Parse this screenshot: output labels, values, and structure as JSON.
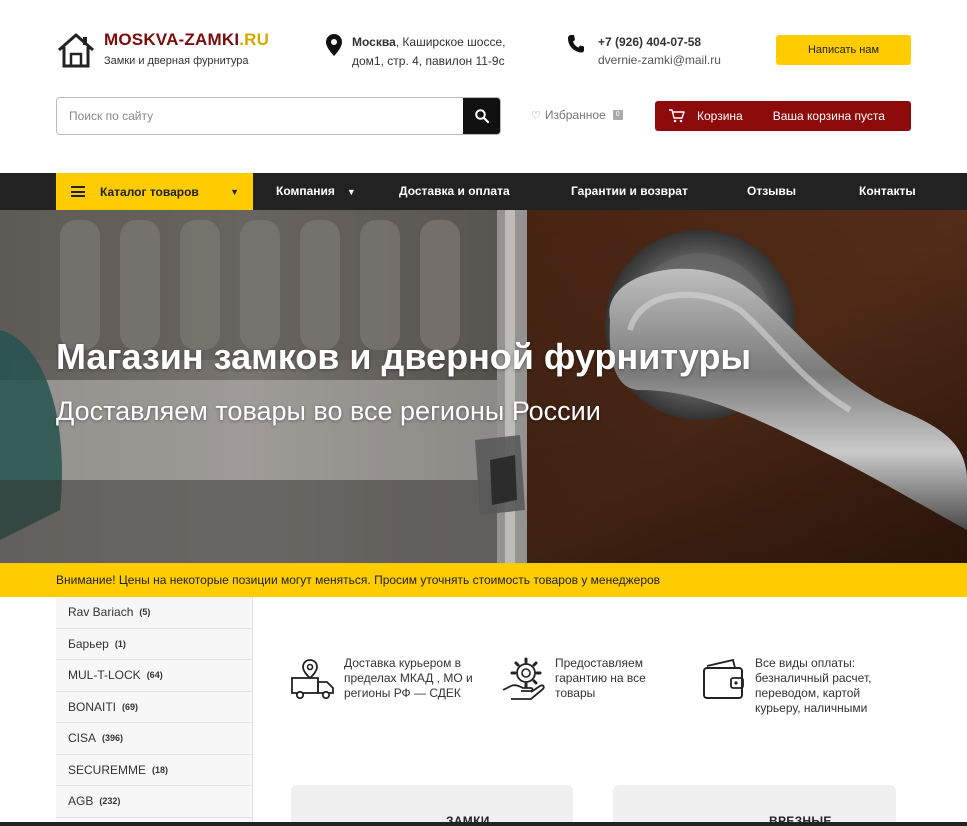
{
  "header": {
    "logo": {
      "brand_part1": "MOSKVA-",
      "brand_part2": "ZAMKI",
      "brand_part3": ".RU",
      "subtitle": "Замки и дверная фурнитура"
    },
    "address": {
      "city": "Москва",
      "line1_rest": ", Каширское шоссе,",
      "line2": "дом1, стр. 4, павилон 11-9с"
    },
    "contacts": {
      "phone": "+7 (926) 404-07-58",
      "email": "dvernie-zamki@mail.ru"
    },
    "write_button": "Написать нам",
    "search": {
      "placeholder": "Поиск по сайту"
    },
    "favorites": {
      "label": "Избранное",
      "count": "0"
    },
    "cart": {
      "label": "Корзина",
      "status": "Ваша корзина пуста"
    }
  },
  "nav": {
    "catalog": "Каталог товаров",
    "items": [
      "Компания",
      "Доставка и оплата",
      "Гарантии и возврат",
      "Отзывы",
      "Контакты"
    ]
  },
  "hero": {
    "title": "Магазин замков и дверной фурнитуры",
    "subtitle": "Доставляем товары во все регионы России"
  },
  "notice": "Внимание! Цены на некоторые позиции могут меняться. Просим уточнять стоимость товаров у менеджеров",
  "sidebar": {
    "items": [
      {
        "name": "Rav Bariach",
        "count": "(5)"
      },
      {
        "name": "Барьер",
        "count": "(1)"
      },
      {
        "name": "MUL-T-LOCK",
        "count": "(64)"
      },
      {
        "name": "BONAITI",
        "count": "(69)"
      },
      {
        "name": "CISA",
        "count": "(396)"
      },
      {
        "name": "SECUREMME",
        "count": "(18)"
      },
      {
        "name": "AGB",
        "count": "(232)"
      }
    ]
  },
  "features": [
    {
      "icon": "delivery-truck-icon",
      "text_lines": [
        "Доставка курьером в",
        "пределах МКАД , МО и",
        "регионы РФ — СДЕК"
      ]
    },
    {
      "icon": "guarantee-gear-icon",
      "text_lines": [
        "Предоставляем",
        "гарантию на все",
        "товары"
      ]
    },
    {
      "icon": "wallet-icon",
      "text_lines": [
        "Все виды оплаты:",
        "безналичный расчет,",
        "переводом, картой",
        "курьеру, наличными"
      ]
    }
  ],
  "cards": [
    {
      "title": "ЗАМКИ"
    },
    {
      "title": "ВРЕЗНЫЕ"
    }
  ],
  "colors": {
    "accent": "#ffcc00",
    "brand_red": "#8c0a0a",
    "nav_bg": "#222222"
  }
}
